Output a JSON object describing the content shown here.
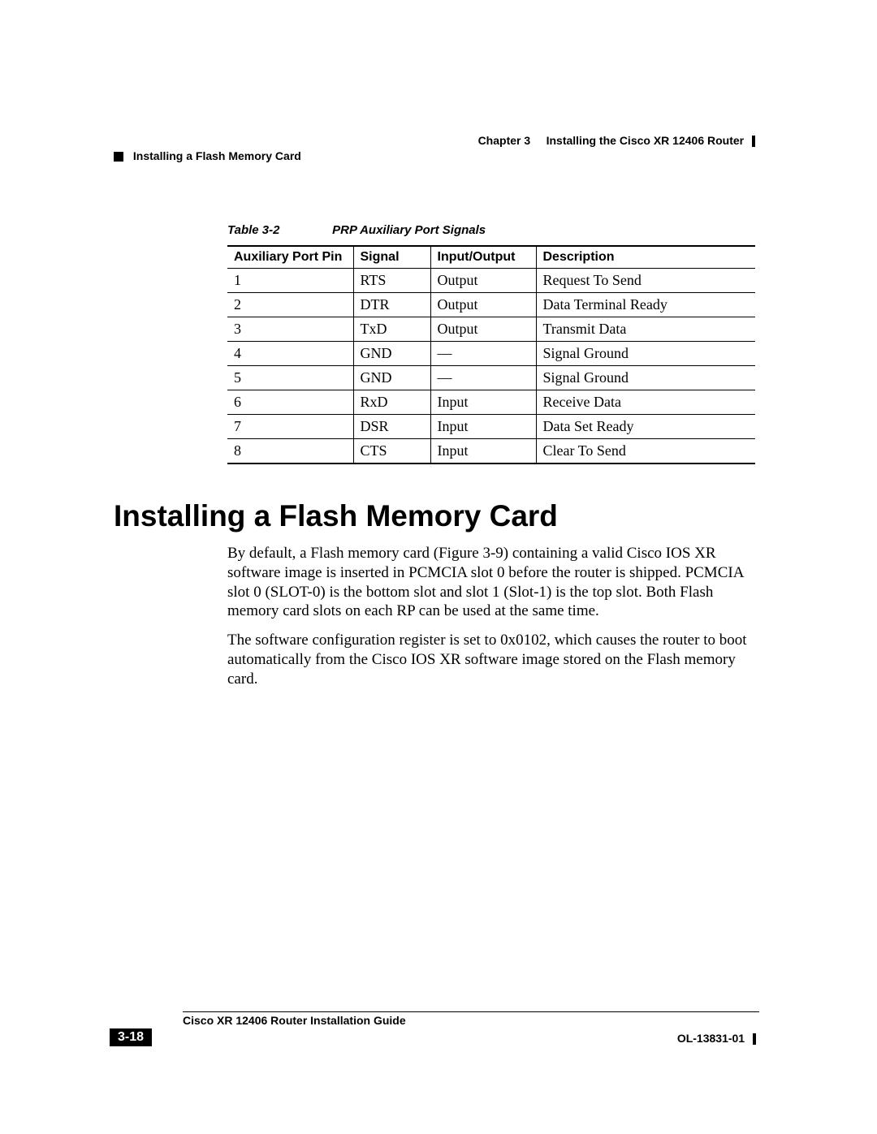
{
  "header": {
    "chapter_label": "Chapter 3",
    "chapter_title": "Installing the Cisco XR 12406 Router",
    "section_title": "Installing a Flash Memory Card"
  },
  "table": {
    "caption_label": "Table 3-2",
    "caption_title": "PRP Auxiliary Port Signals",
    "headers": {
      "pin": "Auxiliary Port Pin",
      "signal": "Signal",
      "io": "Input/Output",
      "desc": "Description"
    },
    "rows": [
      {
        "pin": "1",
        "signal": "RTS",
        "io": "Output",
        "desc": "Request To Send"
      },
      {
        "pin": "2",
        "signal": "DTR",
        "io": "Output",
        "desc": "Data Terminal Ready"
      },
      {
        "pin": "3",
        "signal": "TxD",
        "io": "Output",
        "desc": "Transmit Data"
      },
      {
        "pin": "4",
        "signal": "GND",
        "io": "—",
        "desc": "Signal Ground"
      },
      {
        "pin": "5",
        "signal": "GND",
        "io": "—",
        "desc": "Signal Ground"
      },
      {
        "pin": "6",
        "signal": "RxD",
        "io": "Input",
        "desc": "Receive Data"
      },
      {
        "pin": "7",
        "signal": "DSR",
        "io": "Input",
        "desc": "Data Set Ready"
      },
      {
        "pin": "8",
        "signal": "CTS",
        "io": "Input",
        "desc": "Clear To Send"
      }
    ]
  },
  "heading1": "Installing a Flash Memory Card",
  "paragraphs": {
    "p1": "By default, a Flash memory card (Figure 3-9) containing a valid Cisco IOS XR software image is inserted in PCMCIA slot 0 before the router is shipped. PCMCIA slot 0 (SLOT-0) is the bottom slot and slot 1 (Slot-1) is the top slot. Both Flash memory card slots on each RP can be used at the same time.",
    "p2": "The software configuration register is set to 0x0102, which causes the router to boot automatically from the Cisco IOS XR software image stored on the Flash memory card."
  },
  "footer": {
    "guide_title": "Cisco XR 12406 Router Installation Guide",
    "page_number": "3-18",
    "doc_id": "OL-13831-01"
  }
}
